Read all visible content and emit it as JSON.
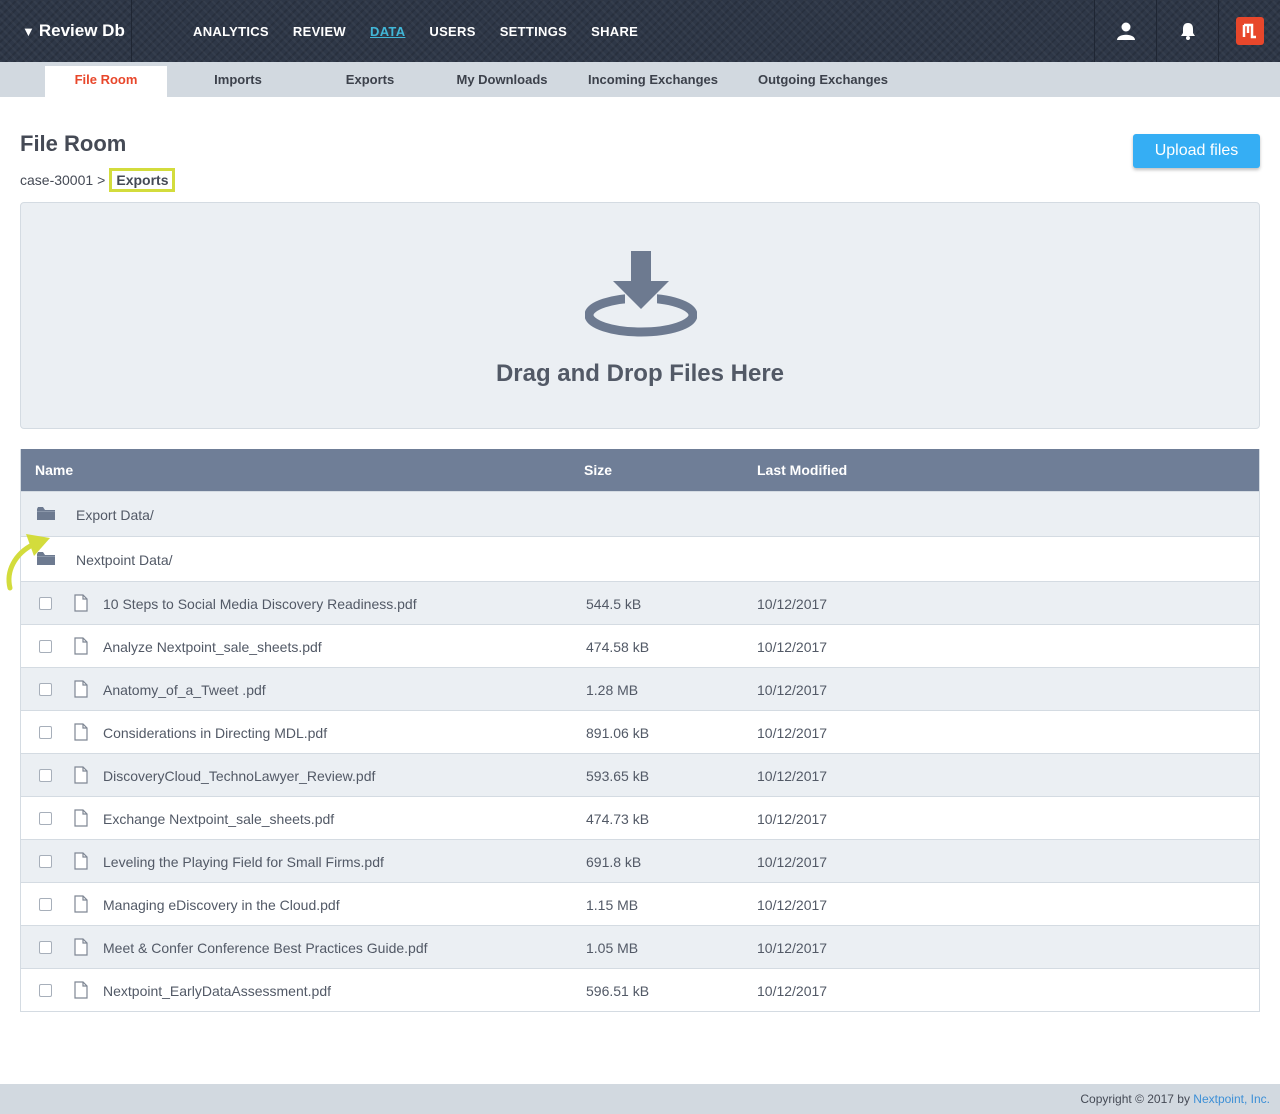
{
  "app": {
    "brand": "Review Db",
    "caret": "▼"
  },
  "nav": {
    "items": [
      "ANALYTICS",
      "REVIEW",
      "DATA",
      "USERS",
      "SETTINGS",
      "SHARE"
    ],
    "active": "DATA"
  },
  "top_icons": [
    "user-icon",
    "bell-icon",
    "nextpoint-logo"
  ],
  "subnav": {
    "tabs": [
      "File Room",
      "Imports",
      "Exports",
      "My Downloads",
      "Incoming Exchanges",
      "Outgoing Exchanges"
    ],
    "active": "File Room"
  },
  "page": {
    "title": "File Room",
    "breadcrumb_root": "case-30001",
    "breadcrumb_sep": ">",
    "breadcrumb_current": "Exports",
    "upload_label": "Upload files"
  },
  "dropzone": {
    "label": "Drag and Drop Files Here",
    "icon": "download-tray-icon"
  },
  "table": {
    "headers": [
      "Name",
      "Size",
      "Last Modified"
    ],
    "folders": [
      "Export Data/",
      "Nextpoint Data/"
    ],
    "files": [
      {
        "name": "10 Steps to Social Media Discovery Readiness.pdf",
        "size": "544.5 kB",
        "modified": "10/12/2017"
      },
      {
        "name": "Analyze Nextpoint_sale_sheets.pdf",
        "size": "474.58 kB",
        "modified": "10/12/2017"
      },
      {
        "name": "Anatomy_of_a_Tweet .pdf",
        "size": "1.28 MB",
        "modified": "10/12/2017"
      },
      {
        "name": "Considerations in Directing MDL.pdf",
        "size": "891.06 kB",
        "modified": "10/12/2017"
      },
      {
        "name": "DiscoveryCloud_TechnoLawyer_Review.pdf",
        "size": "593.65 kB",
        "modified": "10/12/2017"
      },
      {
        "name": "Exchange Nextpoint_sale_sheets.pdf",
        "size": "474.73 kB",
        "modified": "10/12/2017"
      },
      {
        "name": "Leveling the Playing Field for Small Firms.pdf",
        "size": "691.8 kB",
        "modified": "10/12/2017"
      },
      {
        "name": "Managing eDiscovery in the Cloud.pdf",
        "size": "1.15 MB",
        "modified": "10/12/2017"
      },
      {
        "name": "Meet & Confer Conference Best Practices Guide.pdf",
        "size": "1.05 MB",
        "modified": "10/12/2017"
      },
      {
        "name": "Nextpoint_EarlyDataAssessment.pdf",
        "size": "596.51 kB",
        "modified": "10/12/2017"
      }
    ]
  },
  "footer": {
    "copyright": "Copyright © 2017 by ",
    "company": "Nextpoint, Inc."
  },
  "colors": {
    "accent": "#e8472b",
    "active_nav": "#41b7d8",
    "upload": "#35aef4",
    "highlight": "#d3dc3c",
    "table_header": "#6f7e97"
  }
}
